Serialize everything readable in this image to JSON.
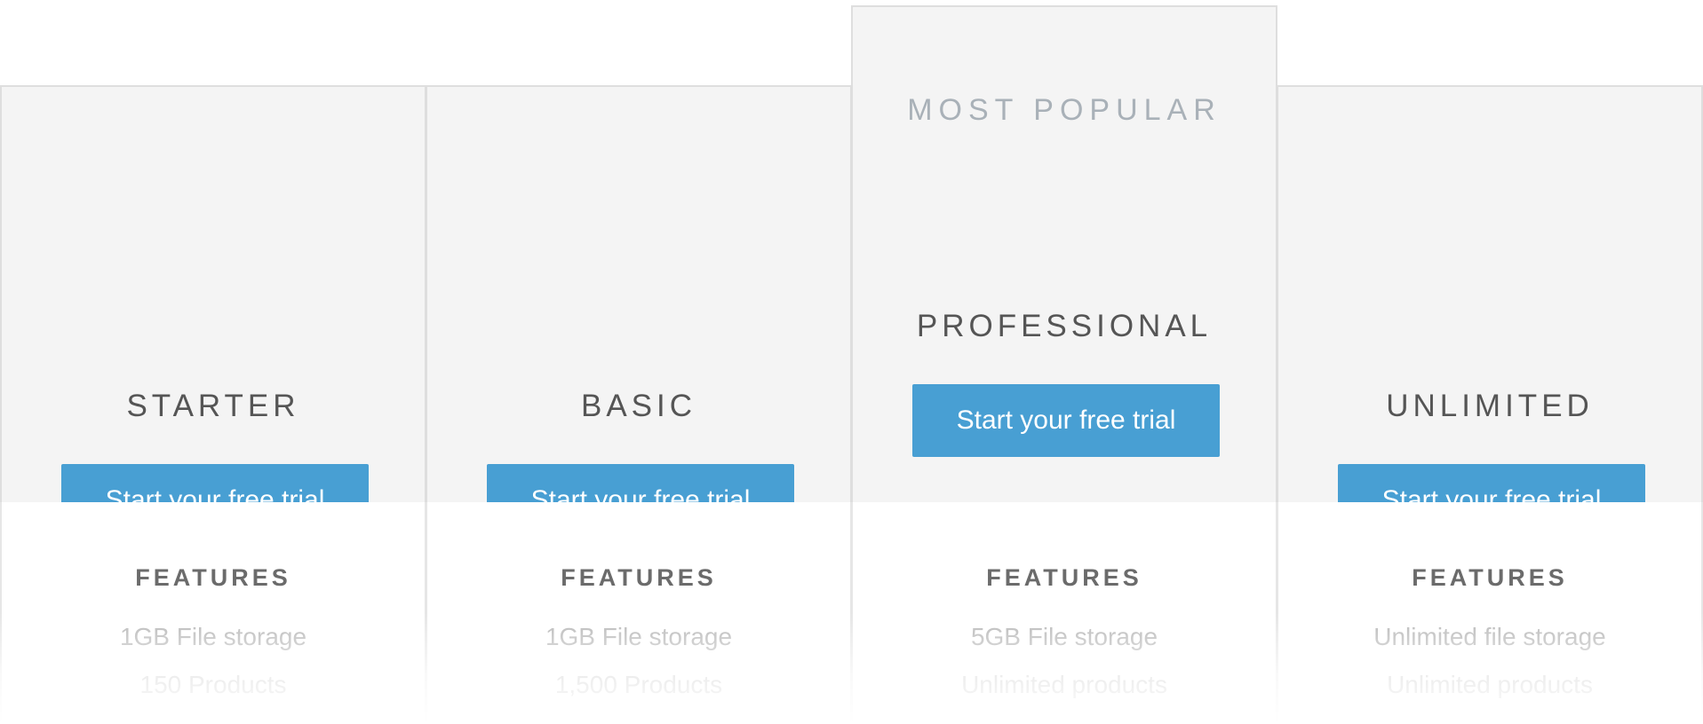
{
  "plans": [
    {
      "name": "STARTER",
      "button_label": "Start your free trial",
      "features_heading": "FEATURES",
      "features": [
        "1GB File storage",
        "150 Products"
      ]
    },
    {
      "name": "BASIC",
      "button_label": "Start your free trial",
      "features_heading": "FEATURES",
      "features": [
        "1GB File storage",
        "1,500 Products"
      ]
    },
    {
      "name": "PROFESSIONAL",
      "badge": "MOST POPULAR",
      "button_label": "Start your free trial",
      "features_heading": "FEATURES",
      "features": [
        "5GB File storage",
        "Unlimited products"
      ]
    },
    {
      "name": "UNLIMITED",
      "button_label": "Start your free trial",
      "features_heading": "FEATURES",
      "features": [
        "Unlimited file storage",
        "Unlimited products"
      ]
    }
  ],
  "colors": {
    "button": "#489fd3",
    "header_background": "#f4f4f4",
    "border": "#dedede",
    "badge_text": "#a9b1b8",
    "plan_name_text": "#555555",
    "feature_text": "#b5b5b5"
  }
}
